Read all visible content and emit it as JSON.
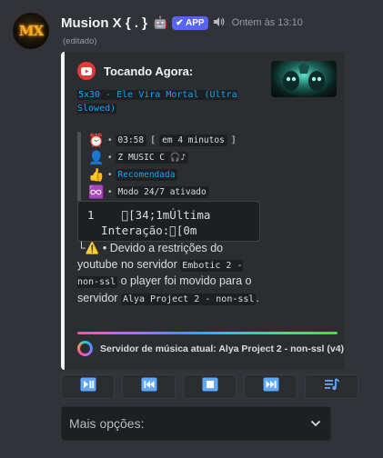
{
  "message": {
    "avatar_text": "MX",
    "username": "Musion X { . }",
    "bot_emoji": "🤖",
    "app_badge": "✔ APP",
    "speaker_icon": "speaker-icon",
    "timestamp": "Ontem às 13:10",
    "edited": "(editado)"
  },
  "embed": {
    "accent_color": "#f2f3f5",
    "author": "Tocando Agora:",
    "author_icon": "youtube-icon",
    "track_title": "5x30 - Ele Vira Mortal (Ultra Slowed)",
    "fields": [
      {
        "emoji": "⏰",
        "icon": "alarm-clock-icon"
      },
      {
        "emoji": "👤",
        "icon": "user-icon"
      },
      {
        "emoji": "👍",
        "icon": "thumbs-up-icon"
      },
      {
        "emoji": "♾️",
        "icon": "infinity-icon"
      }
    ],
    "duration": "03:58",
    "bracket_open": "[",
    "remaining": "em 4 minutos",
    "bracket_close": "]",
    "requester": "Z MUSIC C 🎧♪",
    "recommended": "Recomendada",
    "mode": "Modo 24/7 ativado",
    "code_line1": "1    \u0000[34;1mÚltima",
    "code_line2": "  Interação:\u0000[0m",
    "notice_prefix": "└⚠️ • ",
    "notice_text1": "Devido a restrições do youtube no servidor ",
    "notice_code1": "Embotic 2 - non-ssl",
    "notice_text2": " o player foi movido para o servidor ",
    "notice_code2": "Alya Project 2 - non-ssl",
    "notice_text3": ".",
    "footer_text": "Servidor de música atual: Alya Project 2 - non-ssl (v4)"
  },
  "controls": [
    {
      "name": "play-pause-button",
      "icon": "play-pause-icon"
    },
    {
      "name": "previous-button",
      "icon": "previous-icon"
    },
    {
      "name": "stop-button",
      "icon": "stop-icon"
    },
    {
      "name": "next-button",
      "icon": "next-icon"
    },
    {
      "name": "queue-button",
      "icon": "queue-icon"
    }
  ],
  "select": {
    "placeholder": "Mais opções:"
  },
  "colors": {
    "background": "#313338",
    "embed_bg": "#2b2d31",
    "link_blue": "#00a8fc",
    "badge": "#5865f2"
  }
}
